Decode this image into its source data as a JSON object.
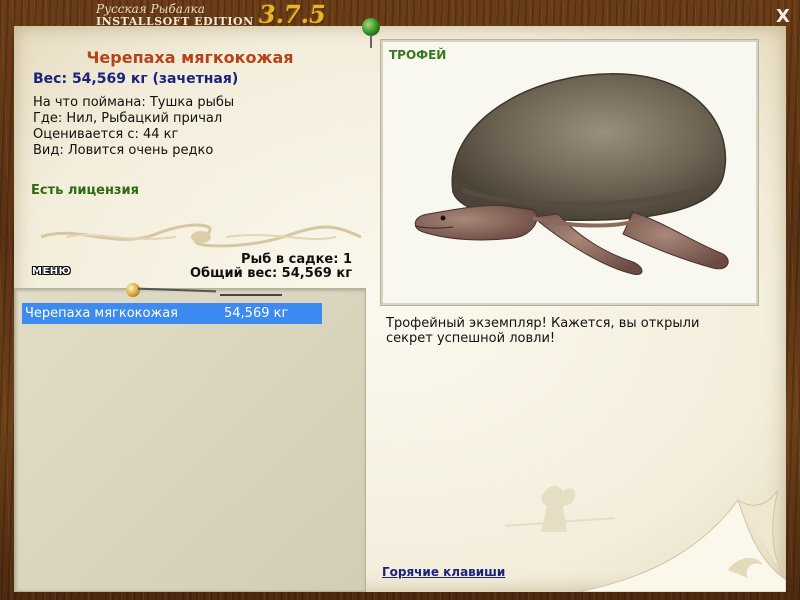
{
  "window": {
    "brand_line1": "Русская Рыбалка",
    "brand_line2": "INSTALLSOFT EDITION",
    "brand_version": "3.7.5",
    "close_label": "X"
  },
  "fish": {
    "title": "Черепаха мягкокожая",
    "weight": "Вес: 54,569 кг (зачетная)",
    "caught_on": "На что поймана: Тушка рыбы",
    "where": "Где: Нил, Рыбацкий причал",
    "valued_from": "Оценивается с: 44 кг",
    "type": "Вид: Ловится очень редко",
    "license": "Есть лицензия"
  },
  "keepnet": {
    "count": "Рыб в садке: 1",
    "total_weight": "Общий вес: 54,569 кг",
    "menu_label": "МЕНЮ",
    "rows": [
      {
        "name": "Черепаха мягкокожая",
        "weight": "54,569 кг"
      }
    ]
  },
  "trophy": {
    "label": "ТРОФЕЙ",
    "image_icon": "softshell-turtle-photo",
    "description": "Трофейный экземпляр! Кажется, вы открыли секрет успешной ловли!"
  },
  "footer": {
    "hotkeys_label": "Горячие клавиши"
  },
  "colors": {
    "title": "#b5441a",
    "weight": "#1a237e",
    "license": "#2d6a12",
    "selection": "#3d8bf0",
    "trophy_label": "#3b7a1a"
  }
}
